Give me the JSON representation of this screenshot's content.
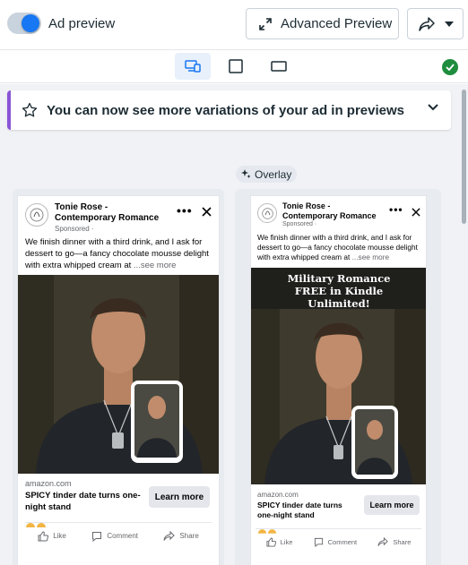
{
  "header": {
    "toggle_label": "Ad preview",
    "toggle_on": true,
    "advanced_preview_label": "Advanced Preview"
  },
  "banner": {
    "text": "You can now see more variations of your ad in previews"
  },
  "overlay_tag": "Overlay",
  "ad": {
    "page_name": "Tonie Rose - Contemporary Romance",
    "sponsored": "Sponsored ·",
    "body": "We finish dinner with a third drink, and I ask for dessert to go—a fancy chocolate mousse delight with extra whipped cream at",
    "see_more": "...see more",
    "domain": "amazon.com",
    "headline": "SPICY tinder date turns one-night stand",
    "cta": "Learn more",
    "like": "Like",
    "comment": "Comment",
    "share": "Share",
    "overlay_text": "Military Romance FREE in Kindle Unlimited!"
  },
  "colors": {
    "accent": "#1877f2",
    "banner_border": "#8a55d6",
    "check": "#1e8e3e",
    "content_bg": "#f0f2f5"
  }
}
